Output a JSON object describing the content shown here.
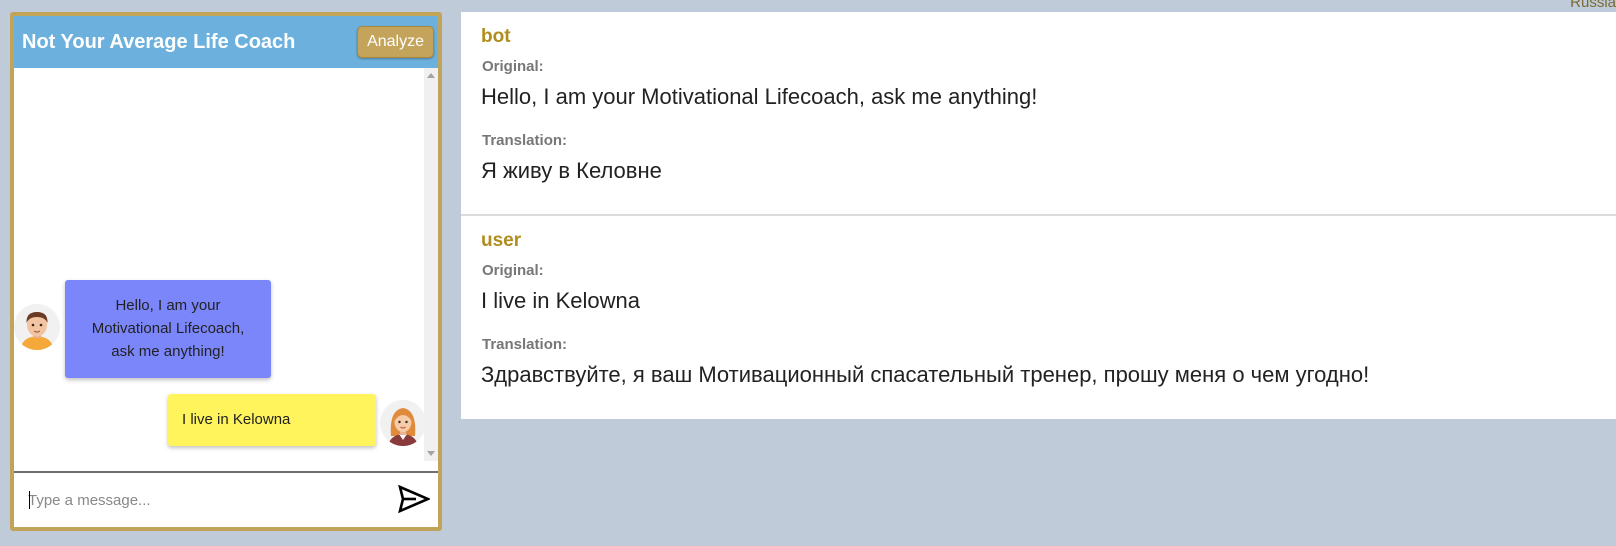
{
  "language_label": "Russia",
  "chat": {
    "title": "Not Your Average Life Coach",
    "analyze_label": "Analyze",
    "messages": [
      {
        "sender": "bot",
        "text": "Hello, I am your Motivational Lifecoach, ask me anything!"
      },
      {
        "sender": "user",
        "text": "I live in Kelowna"
      }
    ],
    "input": {
      "placeholder": "Type a message...",
      "value": ""
    },
    "colors": {
      "header": "#6cb1dd",
      "border": "#c2a35a",
      "bot_bubble": "#7b86fb",
      "user_bubble": "#fff45c"
    }
  },
  "translations": [
    {
      "sender": "bot",
      "original_label": "Original:",
      "original": "Hello, I am your Motivational Lifecoach, ask me anything!",
      "translation_label": "Translation:",
      "translation": "Я живу в Келовне"
    },
    {
      "sender": "user",
      "original_label": "Original:",
      "original": "I live in Kelowna",
      "translation_label": "Translation:",
      "translation": "Здравствуйте, я ваш Мотивационный спасательный тренер, прошу меня о чем угодно!"
    }
  ],
  "icons": {
    "send": "send-icon",
    "bot_avatar": "male-avatar-icon",
    "user_avatar": "female-avatar-icon"
  }
}
